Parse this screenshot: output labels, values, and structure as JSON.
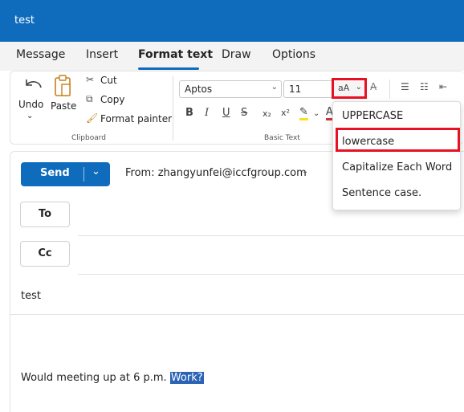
{
  "window": {
    "title": "test"
  },
  "tabs": [
    "Message",
    "Insert",
    "Format text",
    "Draw",
    "Options"
  ],
  "active_tab": "Format text",
  "ribbon": {
    "clipboard": {
      "undo": "Undo",
      "paste": "Paste",
      "cut": "Cut",
      "copy": "Copy",
      "format_painter": "Format painter",
      "group_label": "Clipboard"
    },
    "basic_text": {
      "font": "Aptos",
      "size": "11",
      "change_case": "aA",
      "group_label": "Basic Text",
      "bold": "B",
      "italic": "I",
      "underline": "U",
      "strikethrough": "S",
      "subscript": "x₂",
      "superscript": "x²",
      "font_color": "A"
    }
  },
  "case_menu": {
    "items": [
      "UPPERCASE",
      "lowercase",
      "Capitalize Each Word",
      "Sentence case."
    ],
    "highlighted": "lowercase"
  },
  "compose": {
    "send_label": "Send",
    "from_label": "From:",
    "from_address": "zhangyunfei@iccfgroup.com",
    "to_label": "To",
    "cc_label": "Cc",
    "subject": "test",
    "body_prefix": "Would meeting up at 6 p.m. ",
    "body_selected": "Work?"
  },
  "colors": {
    "accent": "#0f6cbd",
    "highlight_box": "#e81123",
    "selection": "#2c63b5"
  }
}
